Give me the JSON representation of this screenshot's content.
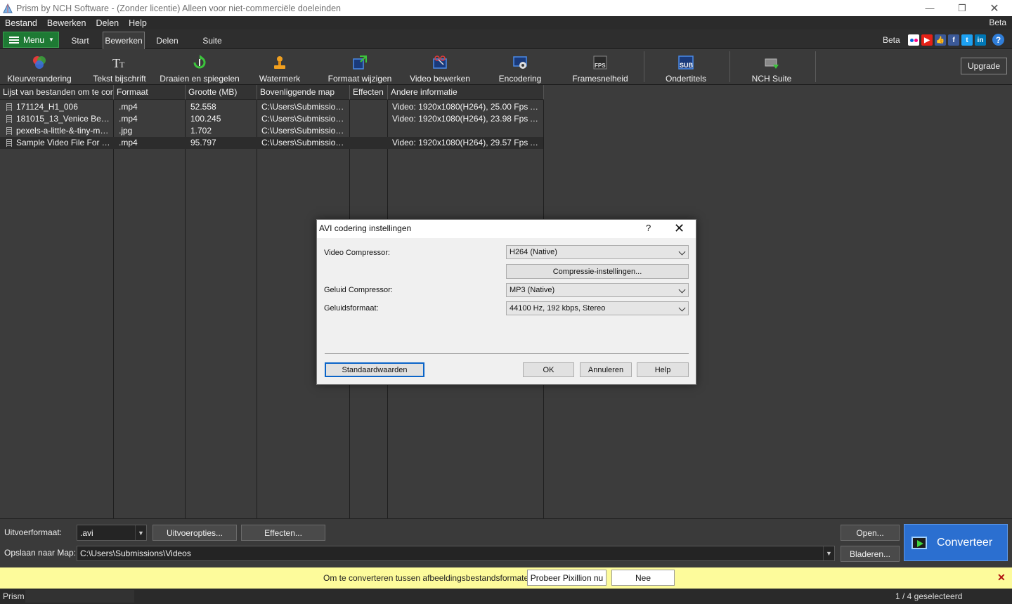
{
  "window": {
    "title": "Prism by NCH Software - (Zonder licentie) Alleen voor niet-commerciële doeleinden",
    "minimize": "—",
    "maximize": "❐",
    "close": "✕"
  },
  "menubar": {
    "items": [
      "Bestand",
      "Bewerken",
      "Delen",
      "Help"
    ],
    "right": "Beta"
  },
  "tabs": {
    "menu_label": "Menu",
    "items": [
      "Start",
      "Bewerken",
      "Delen",
      "Suite"
    ],
    "active": "Bewerken",
    "beta": "Beta",
    "social_icons": [
      "flickr-icon",
      "youtube-icon",
      "thumbs-up-icon",
      "facebook-icon",
      "twitter-icon",
      "linkedin-icon"
    ],
    "help_glyph": "?"
  },
  "toolbar": {
    "items": [
      {
        "label": "Kleurverandering",
        "icon": "color-change-icon"
      },
      {
        "label": "Tekst bijschrift",
        "icon": "text-caption-icon"
      },
      {
        "label": "Draaien en spiegelen",
        "icon": "rotate-flip-icon"
      },
      {
        "label": "Watermerk",
        "icon": "watermark-stamp-icon"
      },
      {
        "label": "Formaat wijzigen",
        "icon": "resize-icon"
      },
      {
        "label": "Video bewerken",
        "icon": "video-edit-icon"
      },
      {
        "label": "Encodering",
        "icon": "encoding-icon"
      },
      {
        "label": "Framesnelheid",
        "icon": "fps-icon"
      },
      {
        "label": "Ondertitels",
        "icon": "subtitles-icon"
      },
      {
        "label": "NCH Suite",
        "icon": "nch-suite-icon"
      }
    ],
    "fps_text": "FPS",
    "sub_text": "SUB",
    "upgrade": "Upgrade"
  },
  "filelist": {
    "columns": [
      "Lijst van bestanden om te con...",
      "Formaat",
      "Grootte (MB)",
      "Bovenliggende map",
      "Effecten",
      "Andere informatie"
    ],
    "rows": [
      {
        "name": "171124_H1_006",
        "format": ".mp4",
        "size": "52.558",
        "folder": "C:\\Users\\Submissions...",
        "effects": "",
        "info": "Video: 1920x1080(H264), 25.00 Fps Au..."
      },
      {
        "name": "181015_13_Venice Beach...",
        "format": ".mp4",
        "size": "100.245",
        "folder": "C:\\Users\\Submissions...",
        "effects": "",
        "info": "Video: 1920x1080(H264), 23.98 Fps Au..."
      },
      {
        "name": "pexels-a-little-&-tiny-man...",
        "format": ".jpg",
        "size": "1.702",
        "folder": "C:\\Users\\Submissions...",
        "effects": "",
        "info": ""
      },
      {
        "name": "Sample Video File For Tes...",
        "format": ".mp4",
        "size": "95.797",
        "folder": "C:\\Users\\Submissions...",
        "effects": "",
        "info": "Video: 1920x1080(H264), 29.57 Fps Au..."
      }
    ]
  },
  "bottom": {
    "output_format_label": "Uitvoerformaat:",
    "output_format_value": ".avi",
    "output_options": "Uitvoeropties...",
    "effects": "Effecten...",
    "save_to_label": "Opslaan naar Map:",
    "save_to_value": "C:\\Users\\Submissions\\Videos",
    "open": "Open...",
    "browse": "Bladeren...",
    "convert": "Converteer"
  },
  "promo": {
    "message": "Om te converteren tussen afbeeldingsbestandsformaten",
    "try": "Probeer Pixillion nu",
    "no": "Nee",
    "close": "✕"
  },
  "status": {
    "left": "Prism",
    "right": "1 / 4 geselecteerd"
  },
  "dialog": {
    "title": "AVI codering instellingen",
    "help": "?",
    "close": "✕",
    "video_compressor_label": "Video Compressor:",
    "video_compressor_value": "H264 (Native)",
    "compression_settings": "Compressie-instellingen...",
    "audio_compressor_label": "Geluid Compressor:",
    "audio_compressor_value": "MP3 (Native)",
    "audio_format_label": "Geluidsformaat:",
    "audio_format_value": "44100 Hz, 192 kbps, Stereo",
    "defaults": "Standaardwaarden",
    "ok": "OK",
    "cancel": "Annuleren",
    "help_button": "Help"
  },
  "colors": {
    "accent_green": "#1e7a34",
    "convert_blue": "#2b6fd0",
    "promo_yellow": "#fdfb9b"
  }
}
